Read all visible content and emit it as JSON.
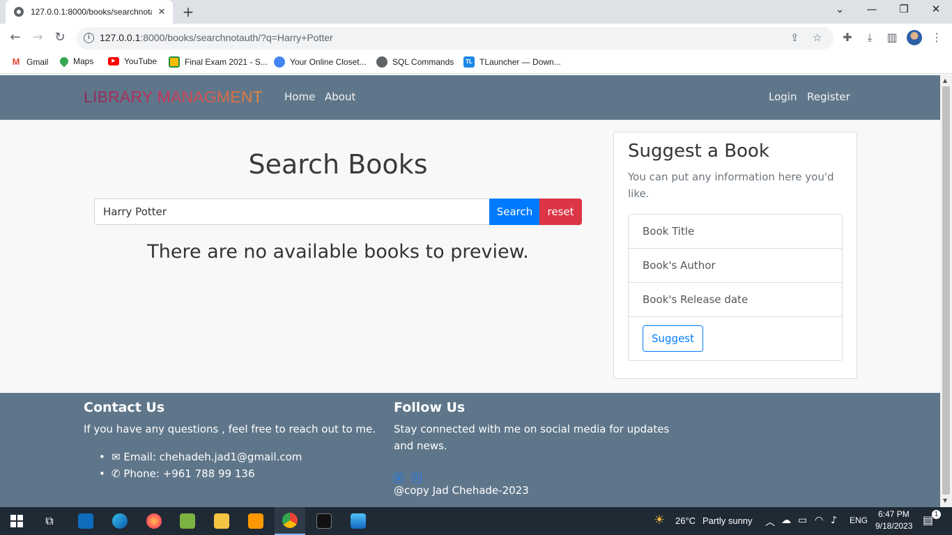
{
  "browser": {
    "tab_title": "127.0.0.1:8000/books/searchnotauth/?q=Harry+Potter",
    "tab_close": "✕",
    "new_tab": "+",
    "url_host": "127.0.0.1",
    "url_rest": ":8000/books/searchnotauth/?q=Harry+Potter",
    "bookmarks": [
      {
        "label": "Gmail",
        "icon": "gmail-icon",
        "color": "#ea4335"
      },
      {
        "label": "Maps",
        "icon": "maps-icon",
        "color": "#34a853"
      },
      {
        "label": "YouTube",
        "icon": "youtube-icon",
        "color": "#ff0000"
      },
      {
        "label": "Final Exam 2021 - S...",
        "icon": "classroom-icon",
        "color": "#fbbc04"
      },
      {
        "label": "Your Online Closet...",
        "icon": "closet-icon",
        "color": "#4285f4"
      },
      {
        "label": "SQL Commands",
        "icon": "globe-icon",
        "color": "#5f6368"
      },
      {
        "label": "TLauncher — Down...",
        "icon": "tlauncher-icon",
        "color": "#1e88e5"
      }
    ]
  },
  "navbar": {
    "brand": "LIBRARY MANAGMENT",
    "links": [
      "Home",
      "About"
    ],
    "login": "Login",
    "register": "Register",
    "bg_color": "#5f768a"
  },
  "search": {
    "title": "Search Books",
    "query": "Harry Potter",
    "search_label": "Search",
    "reset_label": "reset",
    "empty_message": "There are no available books to preview."
  },
  "suggest": {
    "title": "Suggest a Book",
    "text": "You can put any information here you'd like.",
    "fields": [
      "Book Title",
      "Book's Author",
      "Book's Release date"
    ],
    "button": "Suggest"
  },
  "footer": {
    "contact_title": "Contact Us",
    "contact_text": "If you have any questions , feel free to reach out to me.",
    "email": "Email: chehadeh.jad1@gmail.com",
    "phone": "Phone: +961 788 99 136",
    "follow_title": "Follow Us",
    "follow_text": "Stay connected with me on social media for updates and news.",
    "copyright": "@copy Jad Chehade-2023"
  },
  "taskbar": {
    "weather_temp": "26°C",
    "weather_text": "Partly sunny",
    "language": "ENG",
    "time": "6:47 PM",
    "date": "9/18/2023",
    "notifications": "1"
  }
}
